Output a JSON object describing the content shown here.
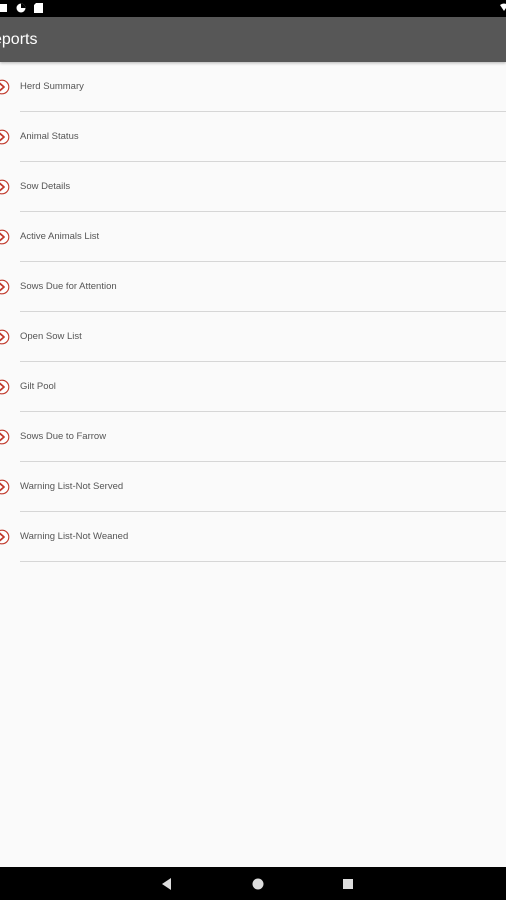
{
  "status_bar": {
    "left_icons": [
      "mail-icon",
      "sync-icon",
      "sd-card-icon"
    ],
    "right_icons": [
      "wifi-icon"
    ]
  },
  "app_bar": {
    "title": "eports"
  },
  "reports": {
    "items": [
      {
        "label": "Herd Summary",
        "icon": "arrow-circle-icon"
      },
      {
        "label": "Animal Status",
        "icon": "arrow-circle-icon"
      },
      {
        "label": "Sow Details",
        "icon": "arrow-circle-icon"
      },
      {
        "label": "Active Animals List",
        "icon": "arrow-circle-icon"
      },
      {
        "label": "Sows Due for Attention",
        "icon": "arrow-circle-icon"
      },
      {
        "label": "Open Sow List",
        "icon": "arrow-circle-icon"
      },
      {
        "label": "Gilt Pool",
        "icon": "arrow-circle-icon"
      },
      {
        "label": "Sows Due to Farrow",
        "icon": "arrow-circle-icon"
      },
      {
        "label": "Warning List-Not Served",
        "icon": "arrow-circle-icon"
      },
      {
        "label": "Warning List-Not Weaned",
        "icon": "arrow-circle-icon"
      }
    ]
  },
  "nav_bar": {
    "buttons": [
      "back-icon",
      "home-icon",
      "recents-icon"
    ]
  },
  "colors": {
    "app_bar": "#575757",
    "icon_accent": "#c0392b",
    "background": "#fafafa",
    "divider": "#d6d6d6"
  }
}
